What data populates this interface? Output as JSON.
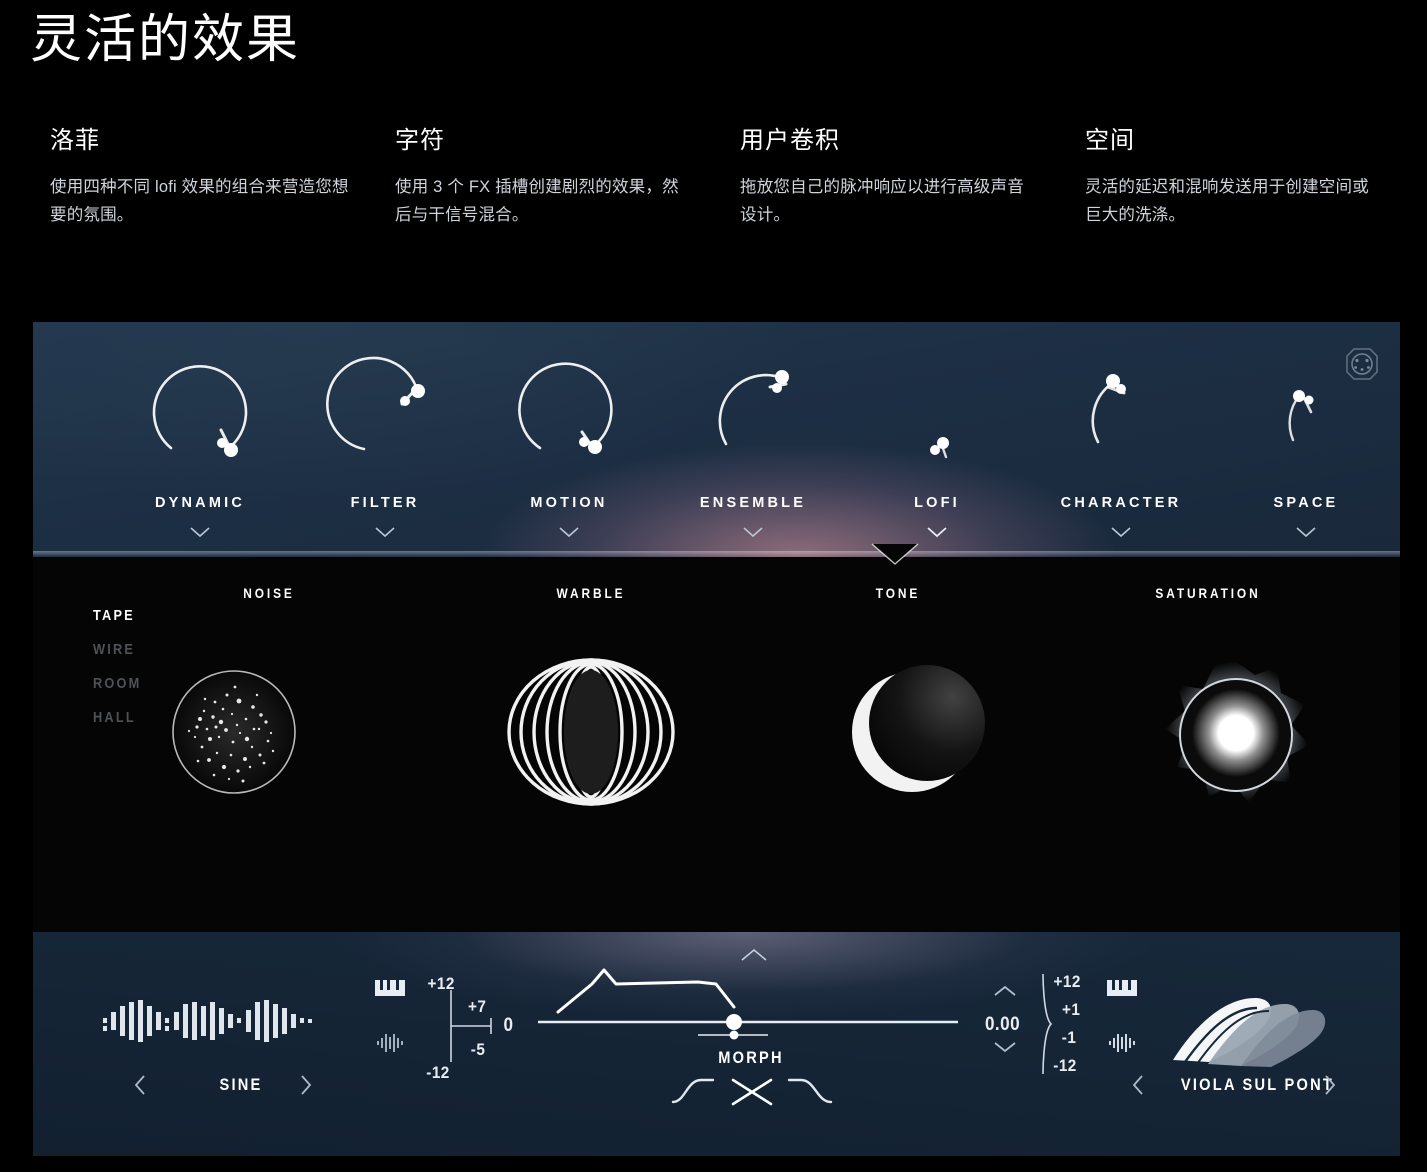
{
  "page": {
    "title": "灵活的效果"
  },
  "features": [
    {
      "title": "洛菲",
      "body": "使用四种不同 lofi 效果的组合来营造您想要的氛围。"
    },
    {
      "title": "字符",
      "body": "使用 3 个 FX 插槽创建剧烈的效果，然后与干信号混合。"
    },
    {
      "title": "用户卷积",
      "body": "拖放您自己的脉冲响应以进行高级声音设计。"
    },
    {
      "title": "空间",
      "body": "灵活的延迟和混响发送用于创建空间或巨大的洗涤。"
    }
  ],
  "plugin": {
    "fx_strip": {
      "midi_icon": "midi-din-icon",
      "items": [
        {
          "label": "DYNAMIC",
          "knob": "arc-near-full"
        },
        {
          "label": "FILTER",
          "knob": "arc-three-quarter"
        },
        {
          "label": "MOTION",
          "knob": "arc-three-quarter-left"
        },
        {
          "label": "ENSEMBLE",
          "knob": "arc-half"
        },
        {
          "label": "LOFI",
          "knob": "arc-min",
          "selected": true
        },
        {
          "label": "CHARACTER",
          "knob": "arc-quarter"
        },
        {
          "label": "SPACE",
          "knob": "arc-small"
        }
      ]
    },
    "editor": {
      "modes": [
        {
          "label": "TAPE",
          "active": true
        },
        {
          "label": "WIRE",
          "active": false
        },
        {
          "label": "ROOM",
          "active": false
        },
        {
          "label": "HALL",
          "active": false
        }
      ],
      "modules": [
        {
          "label": "NOISE",
          "visual": "noise-speckle-circle"
        },
        {
          "label": "WARBLE",
          "visual": "concentric-lens-rings"
        },
        {
          "label": "TONE",
          "visual": "crescent-moon-sphere"
        },
        {
          "label": "SATURATION",
          "visual": "glowing-core-flare"
        }
      ]
    },
    "bottombar": {
      "lfo": {
        "waveform_name": "SINE",
        "prev_icon": "chevron-left-icon",
        "next_icon": "chevron-right-icon",
        "keyboard_icon": "piano-keys-icon",
        "wave_icon": "waveform-icon",
        "range_top": "+12",
        "range_upper": "+7",
        "range_lower": "-5",
        "range_bottom": "-12",
        "value": "0"
      },
      "morph": {
        "label": "MORPH",
        "value_caret": "chevron-up-icon",
        "curve_left_icon": "curve-rise-icon",
        "curve_center_icon": "crossfade-icon",
        "curve_right_icon": "curve-fall-icon"
      },
      "osc": {
        "value": "0.00",
        "up_icon": "chevron-up-icon",
        "down_icon": "chevron-down-icon",
        "range_top": "+12",
        "range_upper": "+1",
        "range_lower": "-1",
        "range_bottom": "-12",
        "keyboard_icon": "piano-keys-icon",
        "wave_icon": "waveform-icon",
        "preset_name": "VIOLA SUL PONT",
        "prev_icon": "chevron-left-icon",
        "next_icon": "chevron-right-icon"
      }
    }
  },
  "colors": {
    "background": "#000000",
    "panel_top": "#1d2f44",
    "panel_bottom": "#152536",
    "editor": "#050505",
    "accent_glow": "#d796a0",
    "text_primary": "#ffffff",
    "text_muted": "#4f5257"
  }
}
